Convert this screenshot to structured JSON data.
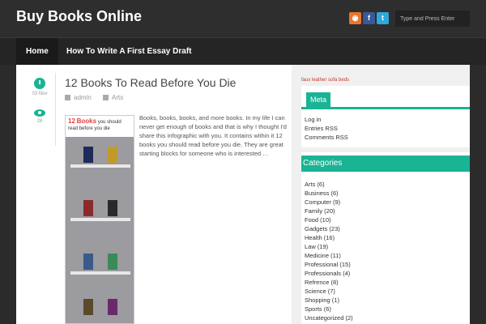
{
  "header": {
    "site_title": "Buy Books Online",
    "search_placeholder": "Type and Press Enter"
  },
  "nav": {
    "items": [
      "Home",
      "How To Write A First Essay Draft"
    ]
  },
  "post": {
    "title": "12 Books To Read Before You Die",
    "date": "03 Nov",
    "views": "28",
    "author": "admin",
    "category": "Arts",
    "excerpt": "Books, books, books, and more books. In my life I can never get enough of books and that is why I thought I'd share this infographic with you. It contains within it 12 books you should read before you die. They are great starting blocks for someone who is interested …",
    "infographic": {
      "headline_num": "12",
      "headline_word": "Books",
      "headline_rest": "you should read before you die"
    }
  },
  "sidebar": {
    "ad_link": "faux leather sofa beds",
    "meta": {
      "title": "Meta",
      "items": [
        "Log in",
        "Entries RSS",
        "Comments RSS"
      ]
    },
    "categories": {
      "title": "Categories",
      "items": [
        "Arts (6)",
        "Business (6)",
        "Computer (9)",
        "Family (20)",
        "Food (10)",
        "Gadgets (23)",
        "Health (16)",
        "Law (19)",
        "Medicine (11)",
        "Professional (15)",
        "Professionals (4)",
        "Refrence (8)",
        "Science (7)",
        "Shopping (1)",
        "Sports (6)",
        "Uncategorized (2)"
      ]
    }
  },
  "colors": {
    "accent": "#1ab394",
    "header": "#2e2e2e",
    "nav": "#252525"
  }
}
